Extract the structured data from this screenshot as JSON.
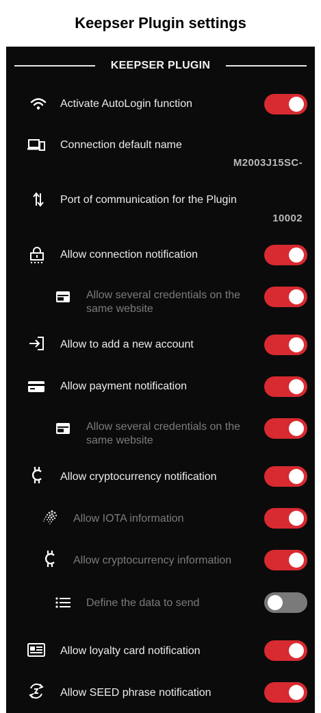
{
  "caption": "Keepser Plugin settings",
  "section_title": "KEEPSER PLUGIN",
  "colors": {
    "accent": "#d82a31",
    "toggle_off": "#7a7a7a",
    "background": "#0b0b0b"
  },
  "settings": {
    "autologin": {
      "label": "Activate AutoLogin function",
      "icon": "wifi-icon",
      "enabled": true
    },
    "connection_name": {
      "label": "Connection default name",
      "value": "M2003J15SC-",
      "icon": "devices-icon"
    },
    "port": {
      "label": "Port of communication for the Plugin",
      "value": "10002",
      "icon": "swap-vertical-icon"
    },
    "connection_notification": {
      "label": "Allow connection notification",
      "icon": "lock-dots-icon",
      "enabled": true
    },
    "several_credentials_1": {
      "label": "Allow several credentials on the same website",
      "icon": "card-window-icon",
      "enabled": true
    },
    "add_account": {
      "label": "Allow to add a new account",
      "icon": "login-arrow-icon",
      "enabled": true
    },
    "payment_notification": {
      "label": "Allow payment notification",
      "icon": "credit-card-icon",
      "enabled": true
    },
    "several_credentials_2": {
      "label": "Allow several credentials on the same website",
      "icon": "card-window-icon",
      "enabled": true
    },
    "crypto_notification": {
      "label": "Allow cryptocurrency notification",
      "icon": "crypto-icon",
      "enabled": true
    },
    "iota_info": {
      "label": "Allow IOTA information",
      "icon": "iota-icon",
      "enabled": true
    },
    "crypto_info": {
      "label": "Allow cryptocurrency information",
      "icon": "crypto-icon",
      "enabled": true
    },
    "data_to_send": {
      "label": "Define the data to send",
      "icon": "list-icon",
      "enabled": false
    },
    "loyalty_card": {
      "label": "Allow loyalty card notification",
      "icon": "id-card-icon",
      "enabled": true
    },
    "seed_phrase": {
      "label": "Allow SEED phrase notification",
      "icon": "seed-sync-icon",
      "enabled": true
    }
  }
}
